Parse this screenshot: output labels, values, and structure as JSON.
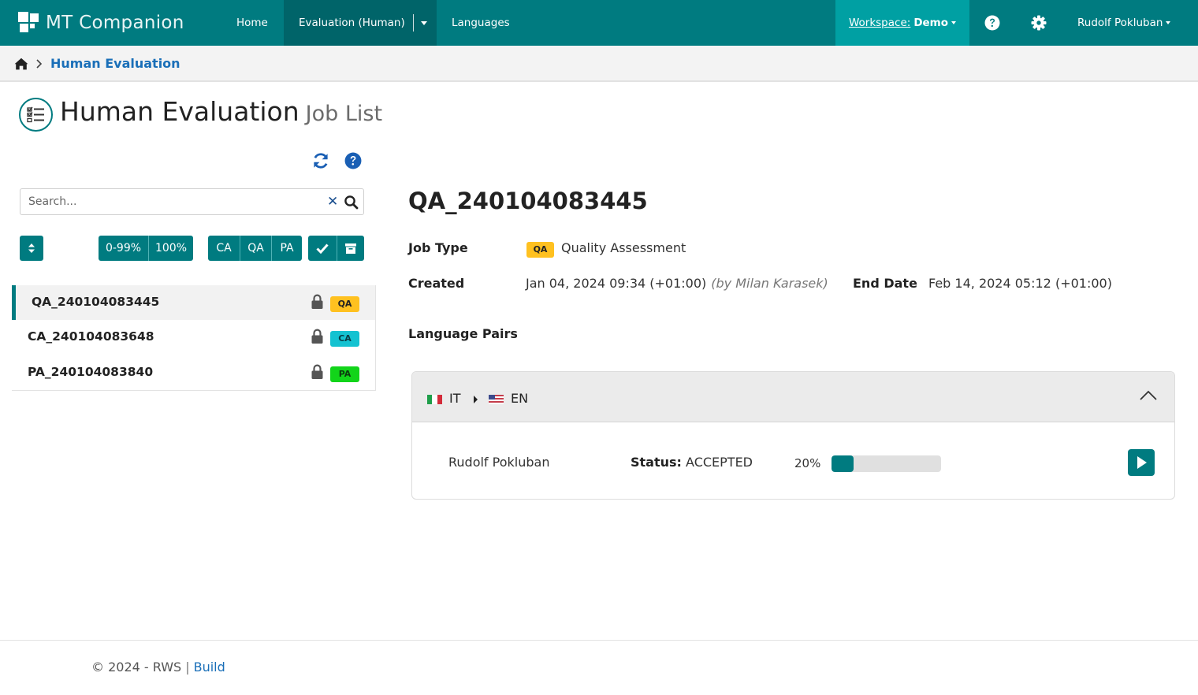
{
  "navbar": {
    "brand": "MT Companion",
    "home": "Home",
    "evaluation": "Evaluation (Human)",
    "languages": "Languages",
    "workspace_label": "Workspace:",
    "workspace_name": "Demo",
    "user": "Rudolf Pokluban",
    "accent_color": "#007b80"
  },
  "breadcrumb": {
    "current": "Human Evaluation"
  },
  "page": {
    "title": "Human Evaluation",
    "subtitle": "Job List"
  },
  "search": {
    "placeholder": "Search..."
  },
  "filters": {
    "range_1": "0-99%",
    "range_2": "100%",
    "type_ca": "CA",
    "type_qa": "QA",
    "type_pa": "PA"
  },
  "jobs": [
    {
      "name": "QA_240104083445",
      "tag": "QA",
      "active": true
    },
    {
      "name": "CA_240104083648",
      "tag": "CA",
      "active": false
    },
    {
      "name": "PA_240104083840",
      "tag": "PA",
      "active": false
    }
  ],
  "detail": {
    "title": "QA_240104083445",
    "job_type_label": "Job Type",
    "job_type_tag": "QA",
    "job_type_value": "Quality Assessment",
    "created_label": "Created",
    "created_value": "Jan 04, 2024 09:34 (+01:00)",
    "created_by": "(by Milan Karasek)",
    "end_date_label": "End Date",
    "end_date_value": "Feb 14, 2024 05:12 (+01:00)",
    "language_pairs_label": "Language Pairs",
    "language_pair": {
      "source": "IT",
      "target": "EN",
      "assignee": "Rudolf Pokluban",
      "status_label": "Status:",
      "status_value": "ACCEPTED",
      "progress_text": "20%",
      "progress": 0.2
    }
  },
  "footer": {
    "copyright": "© 2024 - RWS",
    "separator": "|",
    "link": "Build"
  },
  "icons": {
    "home": "home-icon",
    "refresh": "refresh-icon",
    "help": "help-icon",
    "gear": "gear-icon",
    "lock": "lock-icon",
    "search": "search-icon",
    "clear": "close-icon",
    "sort": "sort-icon",
    "check": "check-icon",
    "archive": "archive-icon",
    "play": "play-icon",
    "chevron": "chevron-up-icon"
  }
}
